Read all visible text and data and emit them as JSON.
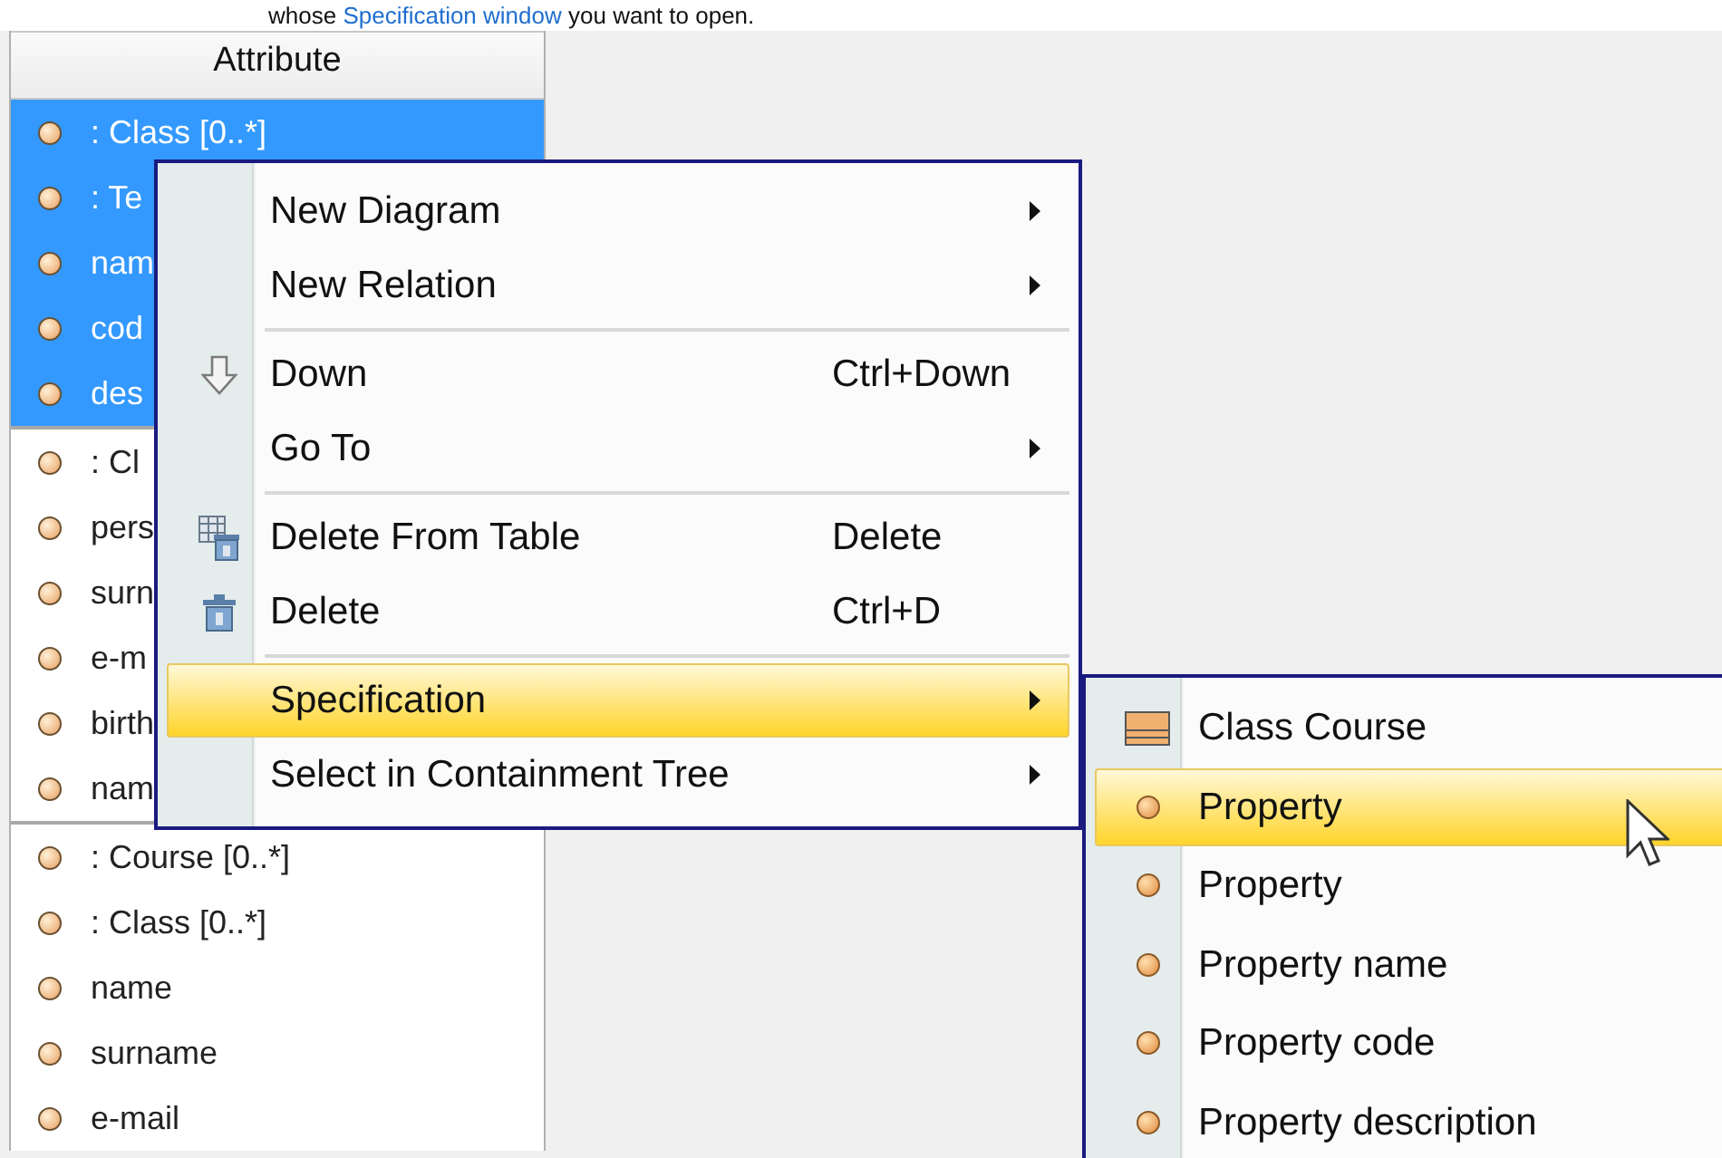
{
  "intro": {
    "before": "whose",
    "link": "Specification window",
    "after": "you want to open."
  },
  "table": {
    "column": "Attribute",
    "groups": [
      {
        "rows": [
          {
            "text": ": Class [0..*]",
            "selected": true
          },
          {
            "text": ": Te",
            "selected": true
          },
          {
            "text": "nam",
            "selected": true
          },
          {
            "text": "cod",
            "selected": true
          },
          {
            "text": "des",
            "selected": true
          }
        ]
      },
      {
        "rows": [
          {
            "text": ": Cl",
            "selected": false
          },
          {
            "text": "pers",
            "selected": false
          },
          {
            "text": "surn",
            "selected": false
          },
          {
            "text": "e-m",
            "selected": false
          },
          {
            "text": "birth",
            "selected": false
          },
          {
            "text": "nam",
            "selected": false
          }
        ]
      },
      {
        "rows": [
          {
            "text": ": Course [0..*]",
            "selected": false
          },
          {
            "text": ": Class [0..*]",
            "selected": false
          },
          {
            "text": "name",
            "selected": false
          },
          {
            "text": "surname",
            "selected": false
          },
          {
            "text": "e-mail",
            "selected": false
          }
        ]
      }
    ]
  },
  "menu": [
    {
      "kind": "plain",
      "label": "New Diagram",
      "submenu": true,
      "selected": false
    },
    {
      "kind": "plain",
      "label": "New Relation",
      "submenu": true,
      "selected": false
    },
    {
      "kind": "separator"
    },
    {
      "kind": "down",
      "label": "Down",
      "shortcut": "Ctrl+Down",
      "selected": false
    },
    {
      "kind": "plain",
      "label": "Go To",
      "submenu": true,
      "selected": false
    },
    {
      "kind": "separator"
    },
    {
      "kind": "remove",
      "label": "Delete From Table",
      "shortcut": "Delete",
      "selected": false
    },
    {
      "kind": "trash",
      "label": "Delete",
      "shortcut": "Ctrl+D",
      "selected": false
    },
    {
      "kind": "separator"
    },
    {
      "kind": "plain",
      "label": "Specification",
      "submenu": true,
      "selected": true
    },
    {
      "kind": "plain",
      "label": "Select in Containment Tree",
      "submenu": true,
      "selected": false
    }
  ],
  "submenu": [
    {
      "kind": "class",
      "label": "Class Course",
      "selected": false
    },
    {
      "kind": "property",
      "label": "Property",
      "selected": true
    },
    {
      "kind": "property",
      "label": "Property",
      "selected": false
    },
    {
      "kind": "property",
      "label": "Property name",
      "selected": false
    },
    {
      "kind": "property",
      "label": "Property code",
      "selected": false
    },
    {
      "kind": "property",
      "label": "Property description",
      "selected": false
    }
  ]
}
